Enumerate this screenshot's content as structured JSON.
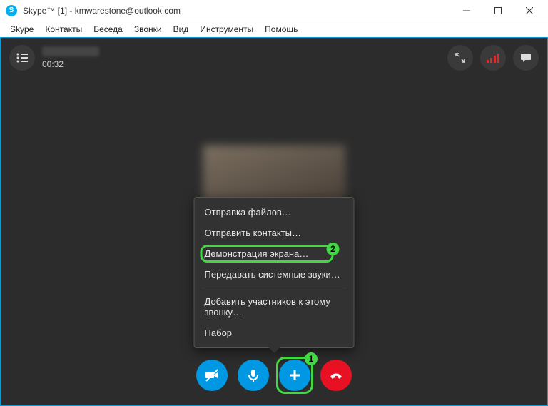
{
  "window": {
    "title": "Skype™ [1] - kmwarestone@outlook.com"
  },
  "menubar": [
    "Skype",
    "Контакты",
    "Беседа",
    "Звонки",
    "Вид",
    "Инструменты",
    "Помощь"
  ],
  "call": {
    "timer": "00:32"
  },
  "popup": {
    "items": [
      "Отправка файлов…",
      "Отправить контакты…",
      "Демонстрация экрана…",
      "Передавать системные звуки…",
      "Добавить участников к этому звонку…",
      "Набор"
    ],
    "highlight_index": 2,
    "separator_after_index": 3
  },
  "annotations": {
    "badge_plus": "1",
    "badge_screen_share": "2"
  },
  "colors": {
    "accent_blue": "#0098e3",
    "highlight_green": "#43d843",
    "hangup_red": "#e81123",
    "surface_dark": "#2c2c2c"
  }
}
